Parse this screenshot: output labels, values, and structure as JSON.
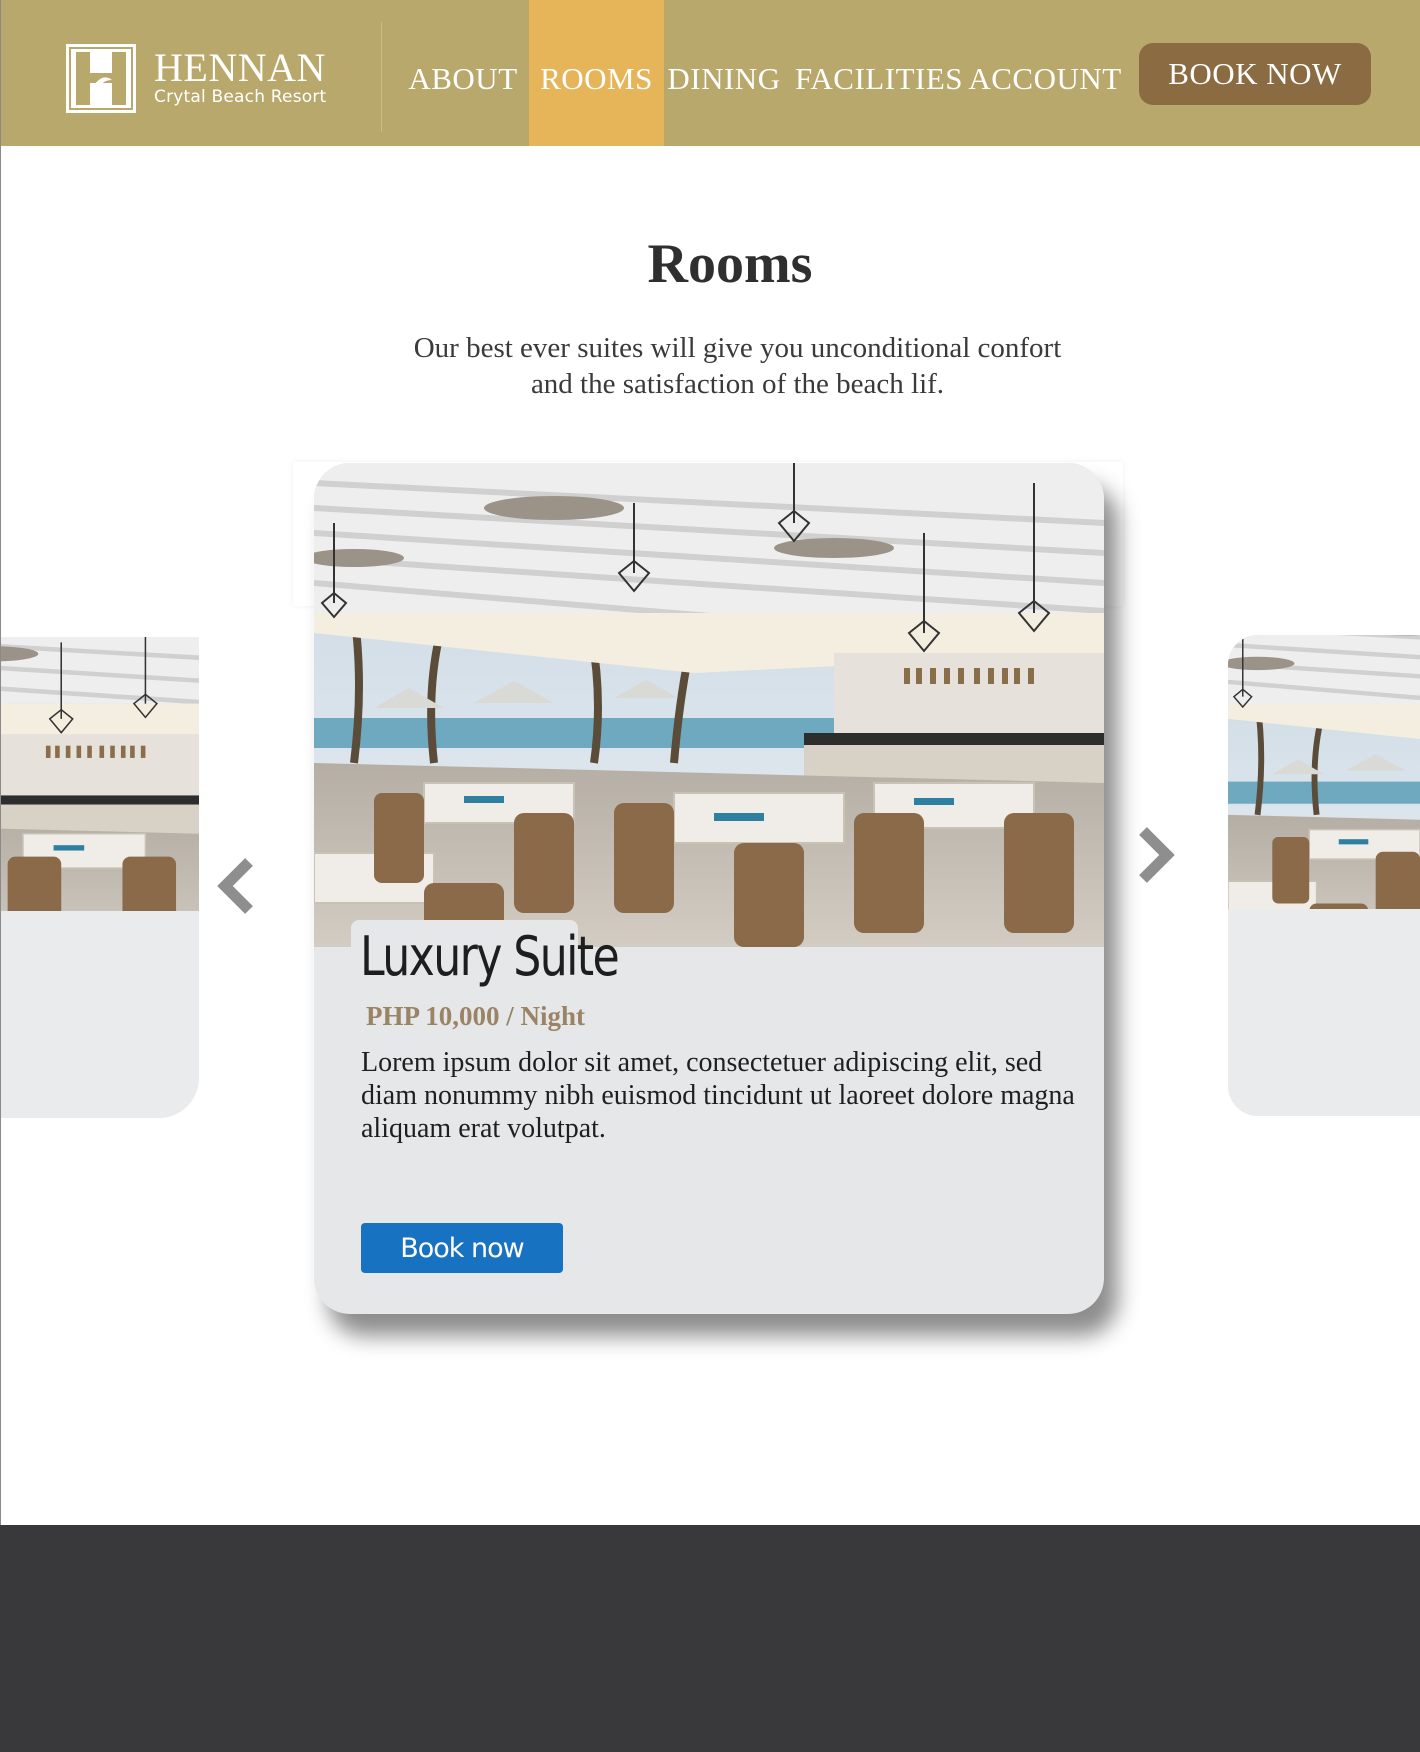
{
  "brand": {
    "name": "HENNAN",
    "subtitle": "Crytal Beach Resort",
    "logo_letter": "H"
  },
  "nav": {
    "items": [
      {
        "label": "ABOUT",
        "active": false
      },
      {
        "label": "ROOMS",
        "active": true
      },
      {
        "label": "DINING",
        "active": false
      },
      {
        "label": "FACILITIES",
        "active": false
      },
      {
        "label": "ACCOUNT",
        "active": false
      }
    ],
    "book_label": "BOOK NOW"
  },
  "page": {
    "title": "Rooms",
    "subtitle_line1": "Our best ever suites will give you unconditional confort",
    "subtitle_line2": "and the satisfaction of the beach lif."
  },
  "carousel": {
    "card": {
      "title": "Luxury Suite",
      "price": "PHP 10,000 / Night",
      "description": "Lorem ipsum dolor sit amet, consectetuer adipiscing elit, sed diam nonummy nibh euismod tincidunt ut laoreet dolore magna aliquam erat volutpat.",
      "book_label": "Book now"
    },
    "prev_icon": "chevron-left-icon",
    "next_icon": "chevron-right-icon"
  },
  "colors": {
    "header_bg": "#b8a86b",
    "nav_active": "#e6b55a",
    "book_button": "#8b6c42",
    "card_button": "#1872c2",
    "price": "#9b8366",
    "footer_bg": "#39393b"
  }
}
